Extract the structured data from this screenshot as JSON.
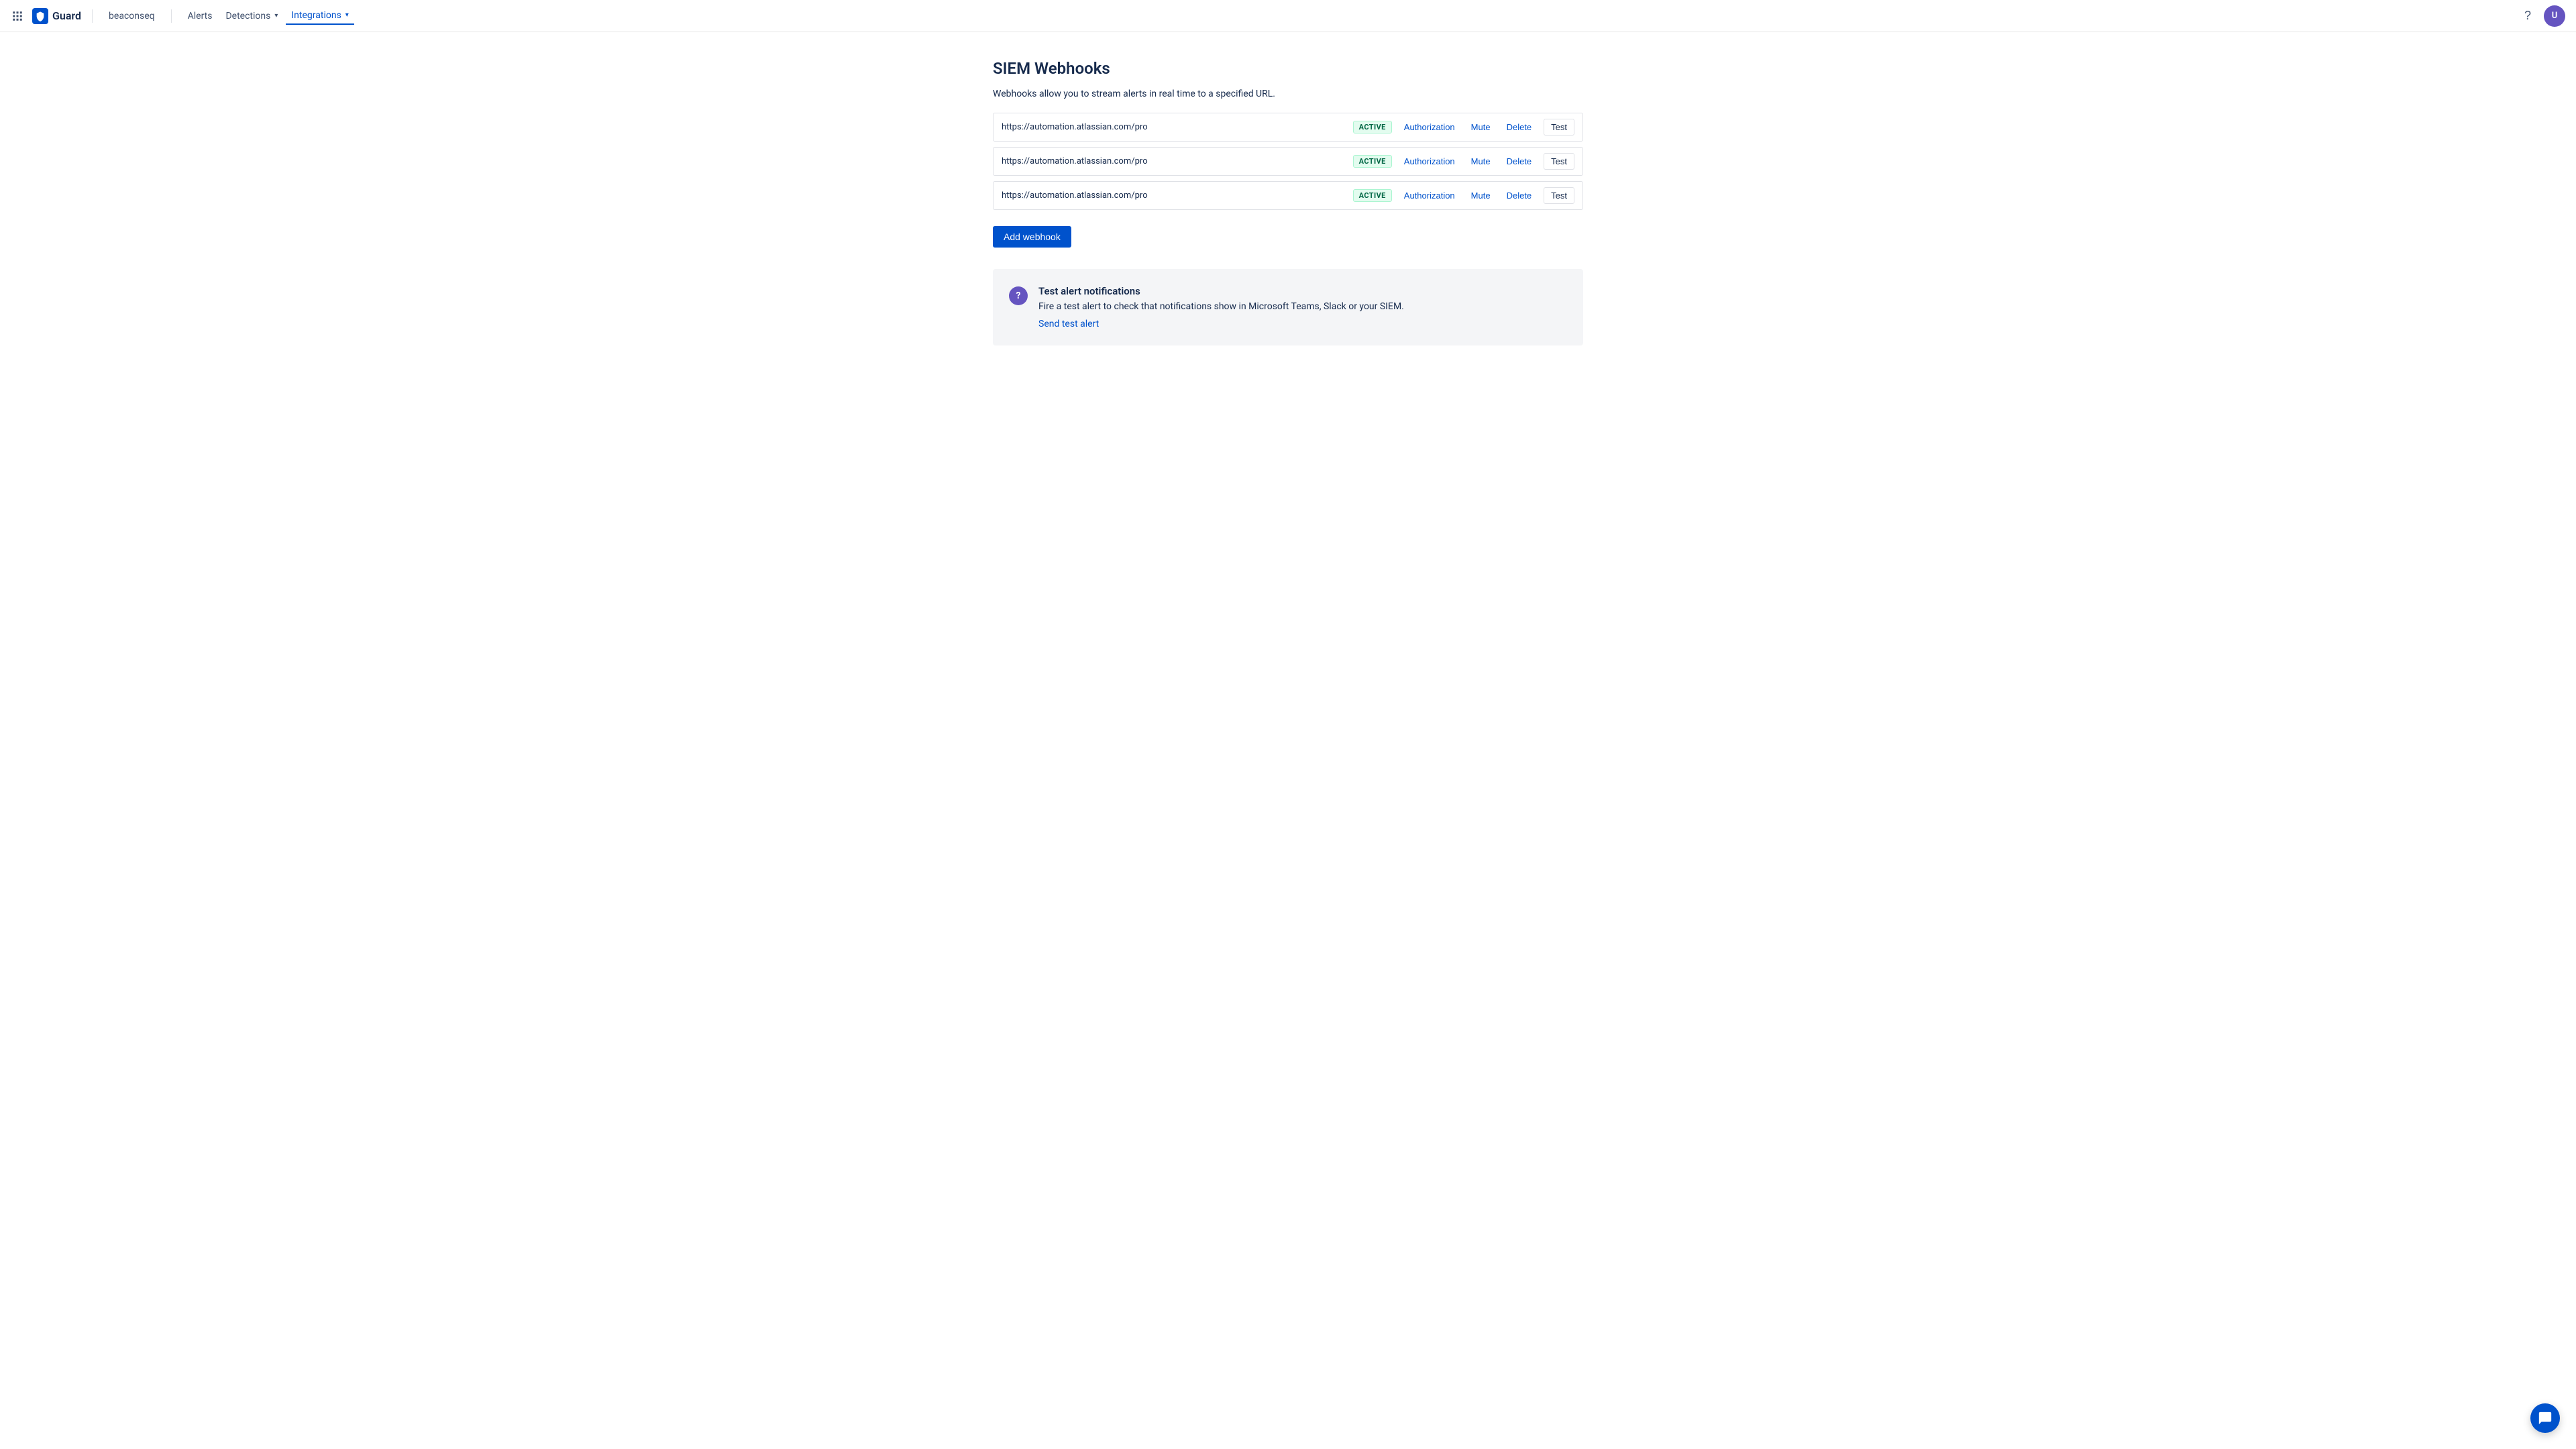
{
  "brand": {
    "name": "Guard"
  },
  "navbar": {
    "workspace": "beaconseq",
    "links": [
      {
        "id": "alerts",
        "label": "Alerts",
        "active": false
      },
      {
        "id": "detections",
        "label": "Detections",
        "active": false,
        "hasDropdown": true
      },
      {
        "id": "integrations",
        "label": "Integrations",
        "active": true,
        "hasDropdown": true
      }
    ]
  },
  "page": {
    "title": "SIEM Webhooks",
    "description": "Webhooks allow you to stream alerts in real time to a specified URL."
  },
  "webhooks": [
    {
      "url": "https://automation.atlassian.com/pro",
      "status": "ACTIVE",
      "auth_label": "Authorization",
      "mute_label": "Mute",
      "delete_label": "Delete",
      "test_label": "Test"
    },
    {
      "url": "https://automation.atlassian.com/pro",
      "status": "ACTIVE",
      "auth_label": "Authorization",
      "mute_label": "Mute",
      "delete_label": "Delete",
      "test_label": "Test"
    },
    {
      "url": "https://automation.atlassian.com/pro",
      "status": "ACTIVE",
      "auth_label": "Authorization",
      "mute_label": "Mute",
      "delete_label": "Delete",
      "test_label": "Test"
    }
  ],
  "add_webhook_btn": "Add webhook",
  "test_alert": {
    "title": "Test alert notifications",
    "description": "Fire a test alert to check that notifications show in Microsoft Teams, Slack or your SIEM.",
    "link_label": "Send test alert"
  },
  "colors": {
    "primary": "#0052cc",
    "active_bg": "#e3fcef",
    "active_text": "#006644"
  }
}
